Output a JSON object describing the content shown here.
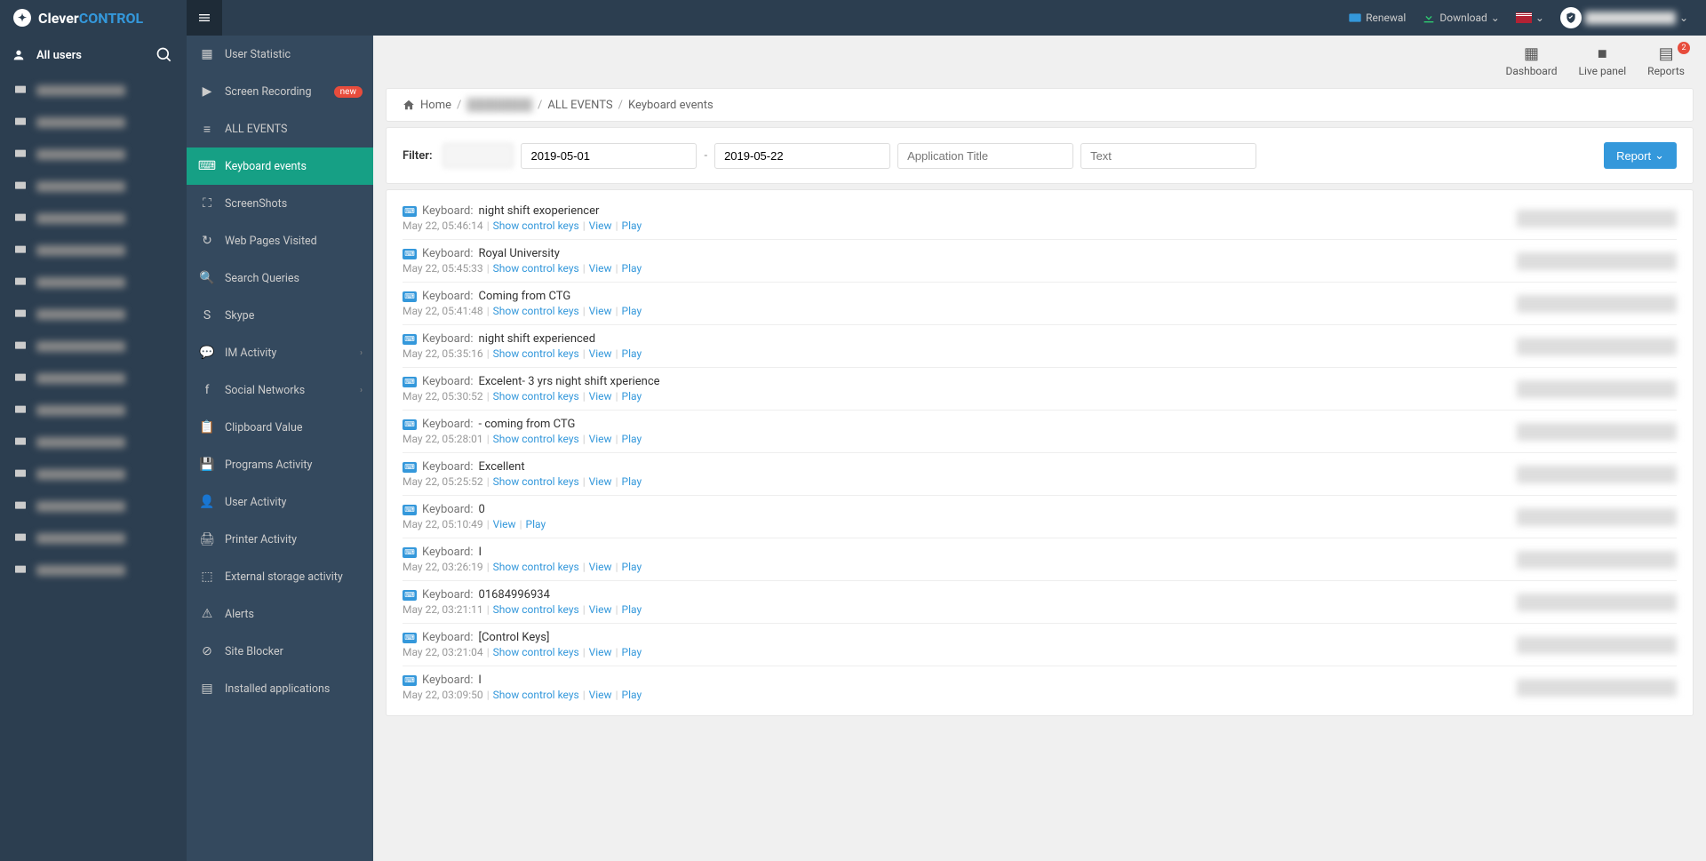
{
  "brand": {
    "part1": "Clever",
    "part2": "CONTROL"
  },
  "header": {
    "renewal": "Renewal",
    "download": "Download",
    "userBlur": "████████████"
  },
  "sidebar1": {
    "title": "All users",
    "users": [
      "u",
      "u",
      "u",
      "u",
      "u",
      "u",
      "u",
      "u",
      "u",
      "u",
      "u",
      "u",
      "u",
      "u",
      "u",
      "u"
    ]
  },
  "sidebar2": {
    "items": [
      {
        "label": "User Statistic",
        "icon": "grid"
      },
      {
        "label": "Screen Recording",
        "icon": "play",
        "badge": "new"
      },
      {
        "label": "ALL EVENTS",
        "icon": "list"
      },
      {
        "label": "Keyboard events",
        "icon": "keyboard",
        "active": true
      },
      {
        "label": "ScreenShots",
        "icon": "expand"
      },
      {
        "label": "Web Pages Visited",
        "icon": "history"
      },
      {
        "label": "Search Queries",
        "icon": "search"
      },
      {
        "label": "Skype",
        "icon": "skype"
      },
      {
        "label": "IM Activity",
        "icon": "chat",
        "chevron": true
      },
      {
        "label": "Social Networks",
        "icon": "facebook",
        "chevron": true
      },
      {
        "label": "Clipboard Value",
        "icon": "clipboard"
      },
      {
        "label": "Programs Activity",
        "icon": "save"
      },
      {
        "label": "User Activity",
        "icon": "user"
      },
      {
        "label": "Printer Activity",
        "icon": "printer"
      },
      {
        "label": "External storage activity",
        "icon": "drive"
      },
      {
        "label": "Alerts",
        "icon": "alert"
      },
      {
        "label": "Site Blocker",
        "icon": "block"
      },
      {
        "label": "Installed applications",
        "icon": "apps"
      }
    ]
  },
  "contentNav": {
    "dashboard": "Dashboard",
    "livepanel": "Live panel",
    "reports": "Reports",
    "reportsBadge": "2"
  },
  "breadcrumb": {
    "home": "Home",
    "hidden": "████████",
    "allEvents": "ALL EVENTS",
    "current": "Keyboard events"
  },
  "filter": {
    "label": "Filter:",
    "dateFrom": "2019-05-01",
    "dateTo": "2019-05-22",
    "appPlaceholder": "Application Title",
    "textPlaceholder": "Text",
    "reportBtn": "Report"
  },
  "events": [
    {
      "text": "night shift exoperiencer",
      "ts": "May 22, 05:46:14",
      "links": [
        "Show control keys",
        "View",
        "Play"
      ]
    },
    {
      "text": "Royal University",
      "ts": "May 22, 05:45:33",
      "links": [
        "Show control keys",
        "View",
        "Play"
      ]
    },
    {
      "text": "Coming from CTG",
      "ts": "May 22, 05:41:48",
      "links": [
        "Show control keys",
        "View",
        "Play"
      ]
    },
    {
      "text": "night shift experienced",
      "ts": "May 22, 05:35:16",
      "links": [
        "Show control keys",
        "View",
        "Play"
      ]
    },
    {
      "text": "Excelent- 3 yrs night shift xperience",
      "ts": "May 22, 05:30:52",
      "links": [
        "Show control keys",
        "View",
        "Play"
      ]
    },
    {
      "text": "- coming from CTG",
      "ts": "May 22, 05:28:01",
      "links": [
        "Show control keys",
        "View",
        "Play"
      ]
    },
    {
      "text": "Excellent",
      "ts": "May 22, 05:25:52",
      "links": [
        "Show control keys",
        "View",
        "Play"
      ]
    },
    {
      "text": "0",
      "ts": "May 22, 05:10:49",
      "links": [
        "View",
        "Play"
      ]
    },
    {
      "text": "I",
      "ts": "May 22, 03:26:19",
      "links": [
        "Show control keys",
        "View",
        "Play"
      ]
    },
    {
      "text": "01684996934",
      "ts": "May 22, 03:21:11",
      "links": [
        "Show control keys",
        "View",
        "Play"
      ]
    },
    {
      "text": "[Control Keys]",
      "ts": "May 22, 03:21:04",
      "links": [
        "Show control keys",
        "View",
        "Play"
      ]
    },
    {
      "text": "l",
      "ts": "May 22, 03:09:50",
      "links": [
        "Show control keys",
        "View",
        "Play"
      ]
    }
  ],
  "labels": {
    "keyboard": "Keyboard:"
  }
}
